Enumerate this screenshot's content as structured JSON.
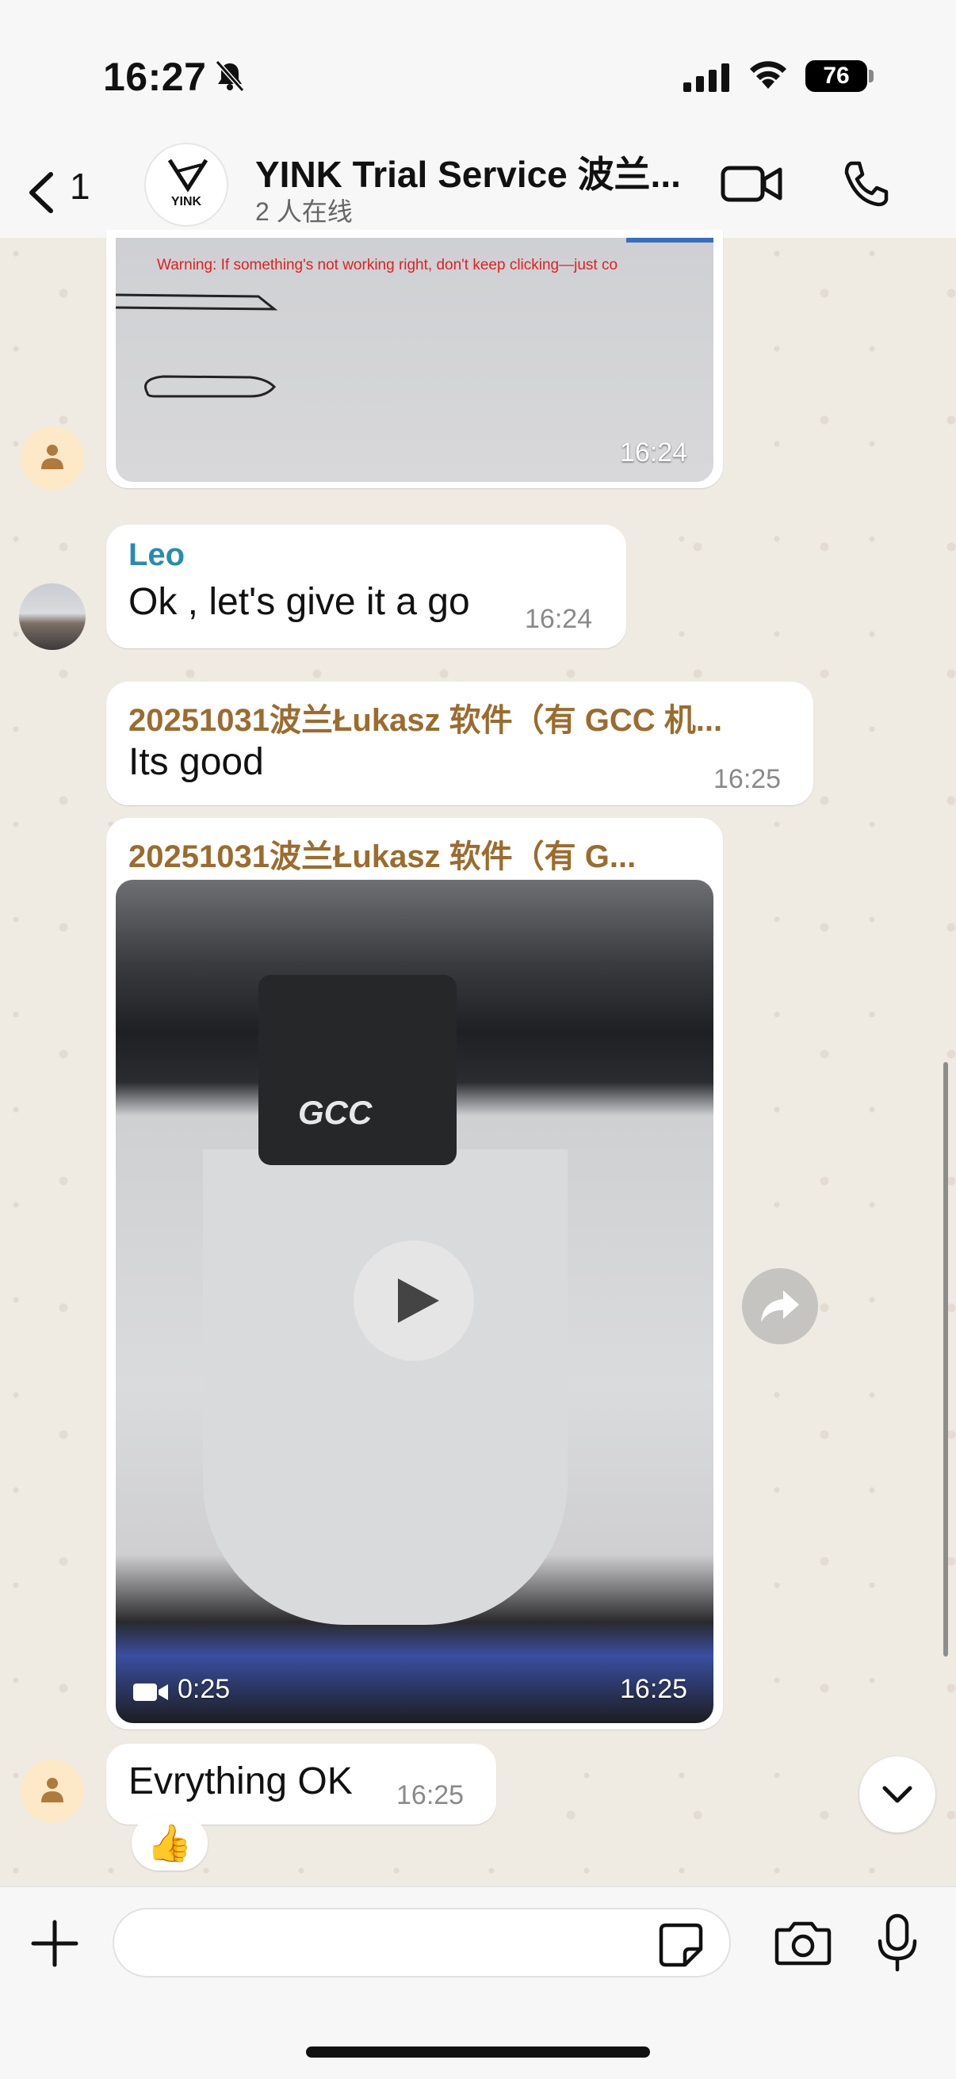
{
  "status_bar": {
    "time": "16:27",
    "battery": "76"
  },
  "header": {
    "back_count": "1",
    "avatar_text": "YINK",
    "title": "YINK Trial Service 波兰...",
    "subtitle": "2 人在线"
  },
  "messages": {
    "image_1": {
      "warning_text": "Warning: If something's not working right, don't keep clicking—just co",
      "time": "16:24"
    },
    "leo": {
      "sender": "Leo",
      "text": "Ok , let's give it a go",
      "time": "16:24"
    },
    "lukasz_1": {
      "sender": "20251031波兰Łukasz 软件（有 GCC 机...",
      "text": "Its good",
      "time": "16:25"
    },
    "lukasz_video": {
      "sender": "20251031波兰Łukasz 软件（有 G...",
      "overlay_text": "GCC",
      "duration": "0:25",
      "time": "16:25"
    },
    "everything": {
      "text": "Evrything OK",
      "time": "16:25",
      "reaction": "👍"
    }
  },
  "colors": {
    "background": "#efeae2",
    "sender_leo": "#2a8bb0",
    "sender_lukasz": "#9c6b2e",
    "bubble": "#ffffff"
  },
  "icons": [
    "silent-bell-icon",
    "signal-icon",
    "wifi-icon",
    "back-icon",
    "video-call-icon",
    "phone-icon",
    "person-icon",
    "play-icon",
    "video-camera-icon",
    "forward-icon",
    "chevron-down-icon",
    "plus-icon",
    "sticker-icon",
    "camera-icon",
    "microphone-icon"
  ]
}
